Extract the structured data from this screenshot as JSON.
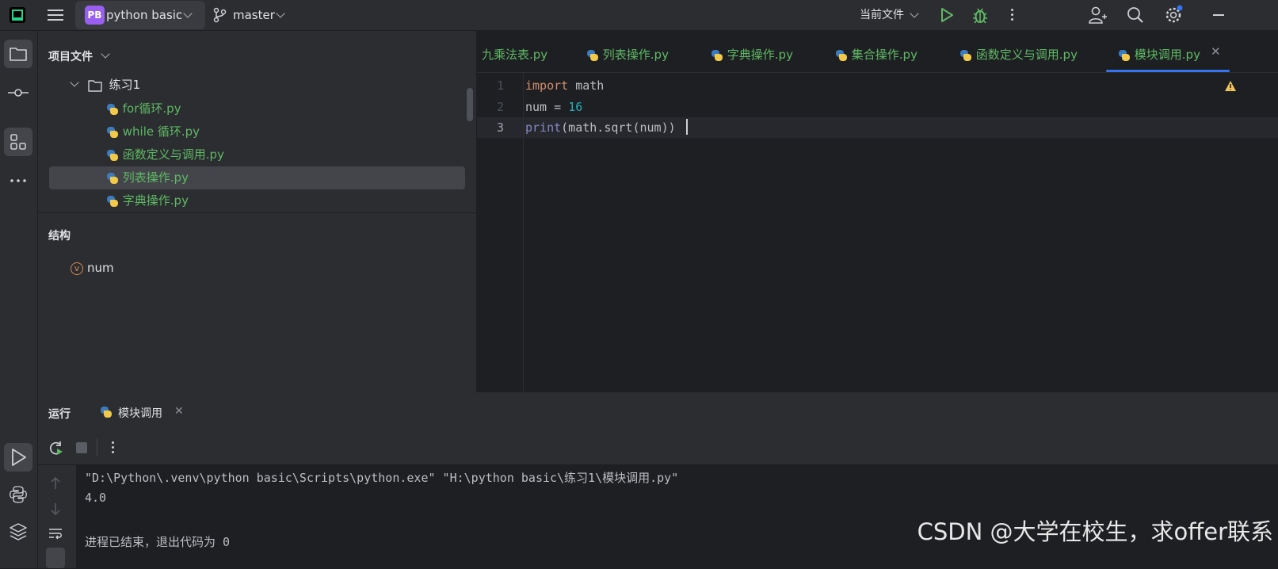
{
  "titlebar": {
    "app_logo": "PC",
    "project_badge": "PB",
    "project_name": "python basic",
    "branch": "master",
    "run_config": "当前文件"
  },
  "project_panel": {
    "title": "项目文件",
    "folder": "练习1",
    "files": [
      "for循环.py",
      "while 循环.py",
      "函数定义与调用.py",
      "列表操作.py",
      "字典操作.py"
    ],
    "selected_index": 3
  },
  "structure_panel": {
    "title": "结构",
    "var_badge": "v",
    "items": [
      "num"
    ]
  },
  "editor": {
    "tabs": [
      "九乘法表.py",
      "列表操作.py",
      "字典操作.py",
      "集合操作.py",
      "函数定义与调用.py",
      "模块调用.py"
    ],
    "active_tab": 5,
    "line_numbers": [
      "1",
      "2",
      "3"
    ],
    "lines": [
      {
        "kw": "import",
        "rest": " math"
      },
      {
        "pre": "num = ",
        "num": "16"
      },
      {
        "fn": "print",
        "rest": "(math.sqrt(num))"
      }
    ]
  },
  "run_panel": {
    "title": "运行",
    "tab_label": "模块调用",
    "console_lines": [
      "\"D:\\Python\\.venv\\python basic\\Scripts\\python.exe\" \"H:\\python basic\\练习1\\模块调用.py\"",
      "4.0",
      "",
      "进程已结束，退出代码为 0"
    ]
  },
  "watermark": "CSDN @大学在校生，求offer联系",
  "colors": {
    "accent": "#3574f0",
    "file_green": "#5fb865",
    "keyword": "#cf8e6d",
    "number": "#2aacb8",
    "builtin": "#8888c6"
  }
}
